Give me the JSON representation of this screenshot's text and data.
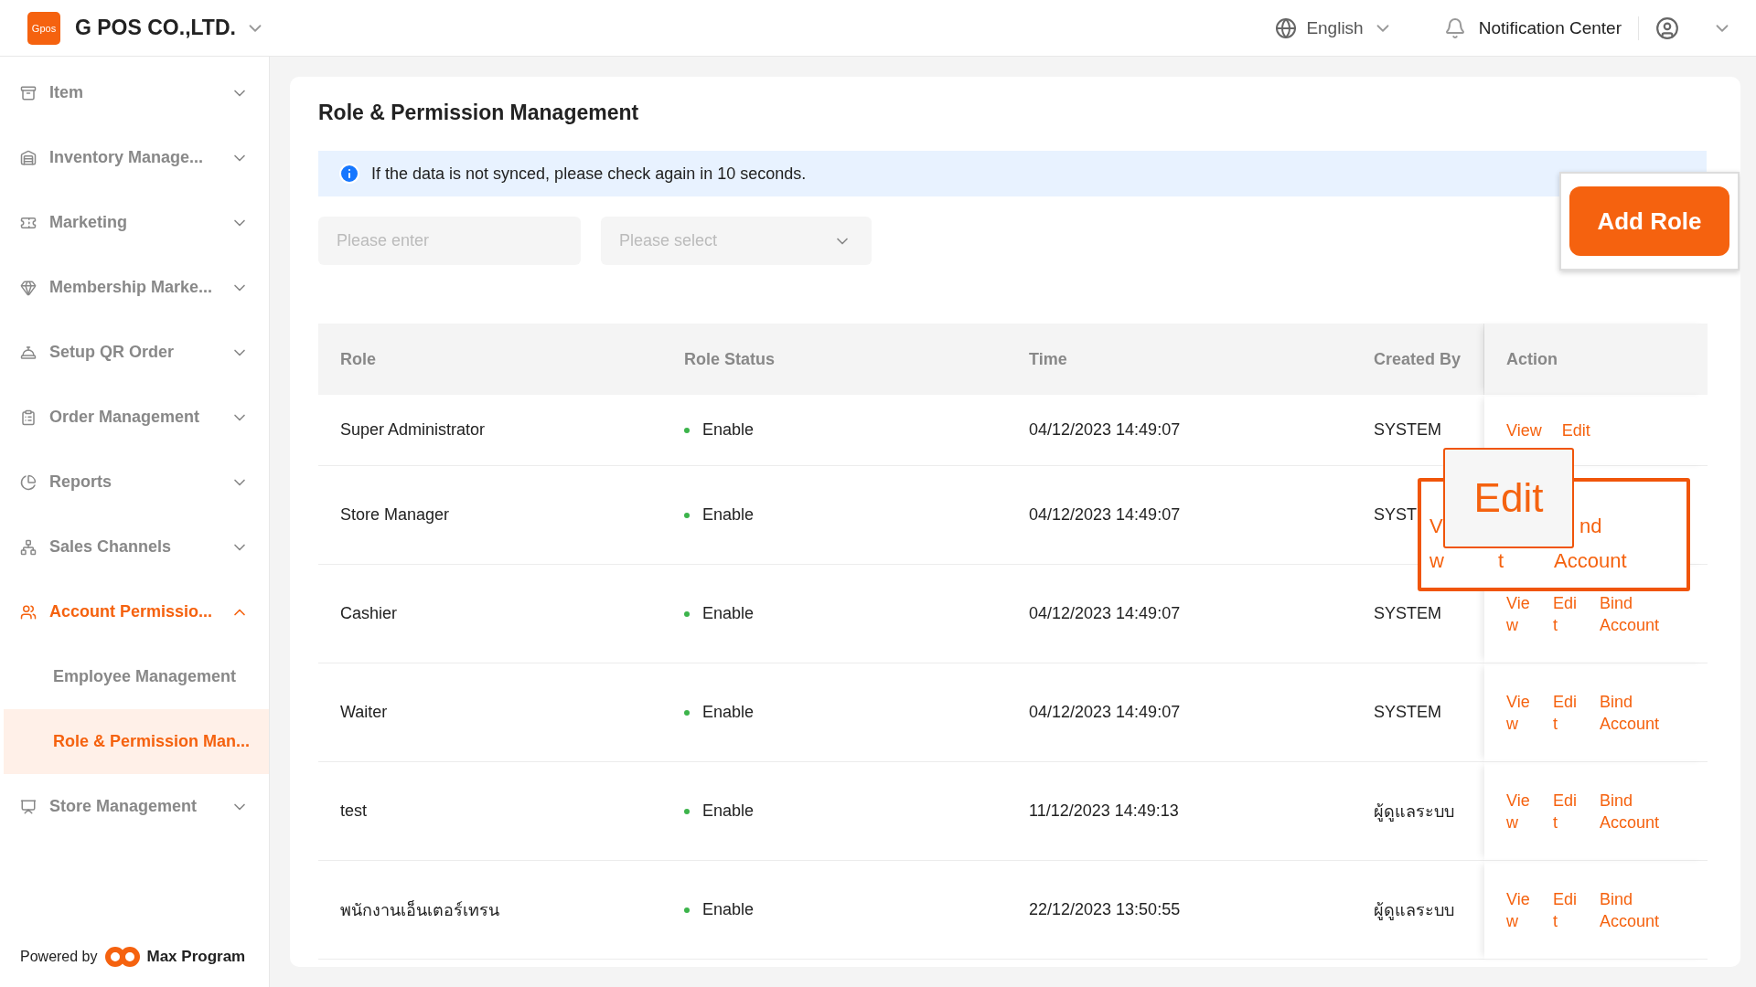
{
  "header": {
    "logo": "Gpos",
    "company": "G POS CO.,LTD.",
    "language": "English",
    "notification": "Notification Center"
  },
  "sidebar": {
    "items": [
      {
        "label": "Item",
        "expanded": false,
        "selected": false
      },
      {
        "label": "Inventory Manage...",
        "expanded": false,
        "selected": false
      },
      {
        "label": "Marketing",
        "expanded": false,
        "selected": false
      },
      {
        "label": "Membership Marke...",
        "expanded": false,
        "selected": false
      },
      {
        "label": "Setup QR Order",
        "expanded": false,
        "selected": false
      },
      {
        "label": "Order Management",
        "expanded": false,
        "selected": false
      },
      {
        "label": "Reports",
        "expanded": false,
        "selected": false
      },
      {
        "label": "Sales Channels",
        "expanded": false,
        "selected": false
      },
      {
        "label": "Account Permissio...",
        "expanded": true,
        "selected": true,
        "children": [
          {
            "label": "Employee Management",
            "selected": false
          },
          {
            "label": "Role & Permission Man...",
            "selected": true
          }
        ]
      },
      {
        "label": "Store Management",
        "expanded": false,
        "selected": false
      }
    ],
    "footer": {
      "prefix": "Powered by",
      "brand": "Max Program"
    }
  },
  "page": {
    "title": "Role & Permission Management",
    "notice": "If the data is not synced, please check again in 10 seconds.",
    "search": {
      "placeholder": "Please enter"
    },
    "filter": {
      "placeholder": "Please select"
    },
    "add_button": {
      "label": "Add Role",
      "highlighted": true
    },
    "zoom_callout": {
      "label": "Edit"
    },
    "magnifier": {
      "columns": [
        {
          "top": "V",
          "bottom": "w"
        },
        {
          "bottom": "t"
        },
        {
          "top": "nd",
          "bottom": "Account"
        }
      ]
    },
    "table": {
      "columns": [
        "Role",
        "Role Status",
        "Time",
        "Created By",
        "Action"
      ],
      "rows": [
        {
          "role": "Super Administrator",
          "status": "Enable",
          "time": "04/12/2023 14:49:07",
          "created_by": "SYSTEM",
          "actions": [
            "View",
            "Edit"
          ]
        },
        {
          "role": "Store Manager",
          "status": "Enable",
          "time": "04/12/2023 14:49:07",
          "created_by": "SYST"
        },
        {
          "role": "Cashier",
          "status": "Enable",
          "time": "04/12/2023 14:49:07",
          "created_by": "SYSTEM",
          "actions": [
            "View",
            "Edit",
            "Bind Account"
          ]
        },
        {
          "role": "Waiter",
          "status": "Enable",
          "time": "04/12/2023 14:49:07",
          "created_by": "SYSTEM",
          "actions": [
            "View",
            "Edit",
            "Bind Account"
          ]
        },
        {
          "role": "test",
          "status": "Enable",
          "time": "11/12/2023 14:49:13",
          "created_by": "ผู้ดูแลระบบ",
          "actions": [
            "View",
            "Edit",
            "Bind Account"
          ]
        },
        {
          "role": "พนักงานเอ็นเตอร์เทรน",
          "status": "Enable",
          "time": "22/12/2023 13:50:55",
          "created_by": "ผู้ดูแลระบบ",
          "actions": [
            "View",
            "Edit",
            "Bind Account"
          ]
        }
      ]
    }
  }
}
